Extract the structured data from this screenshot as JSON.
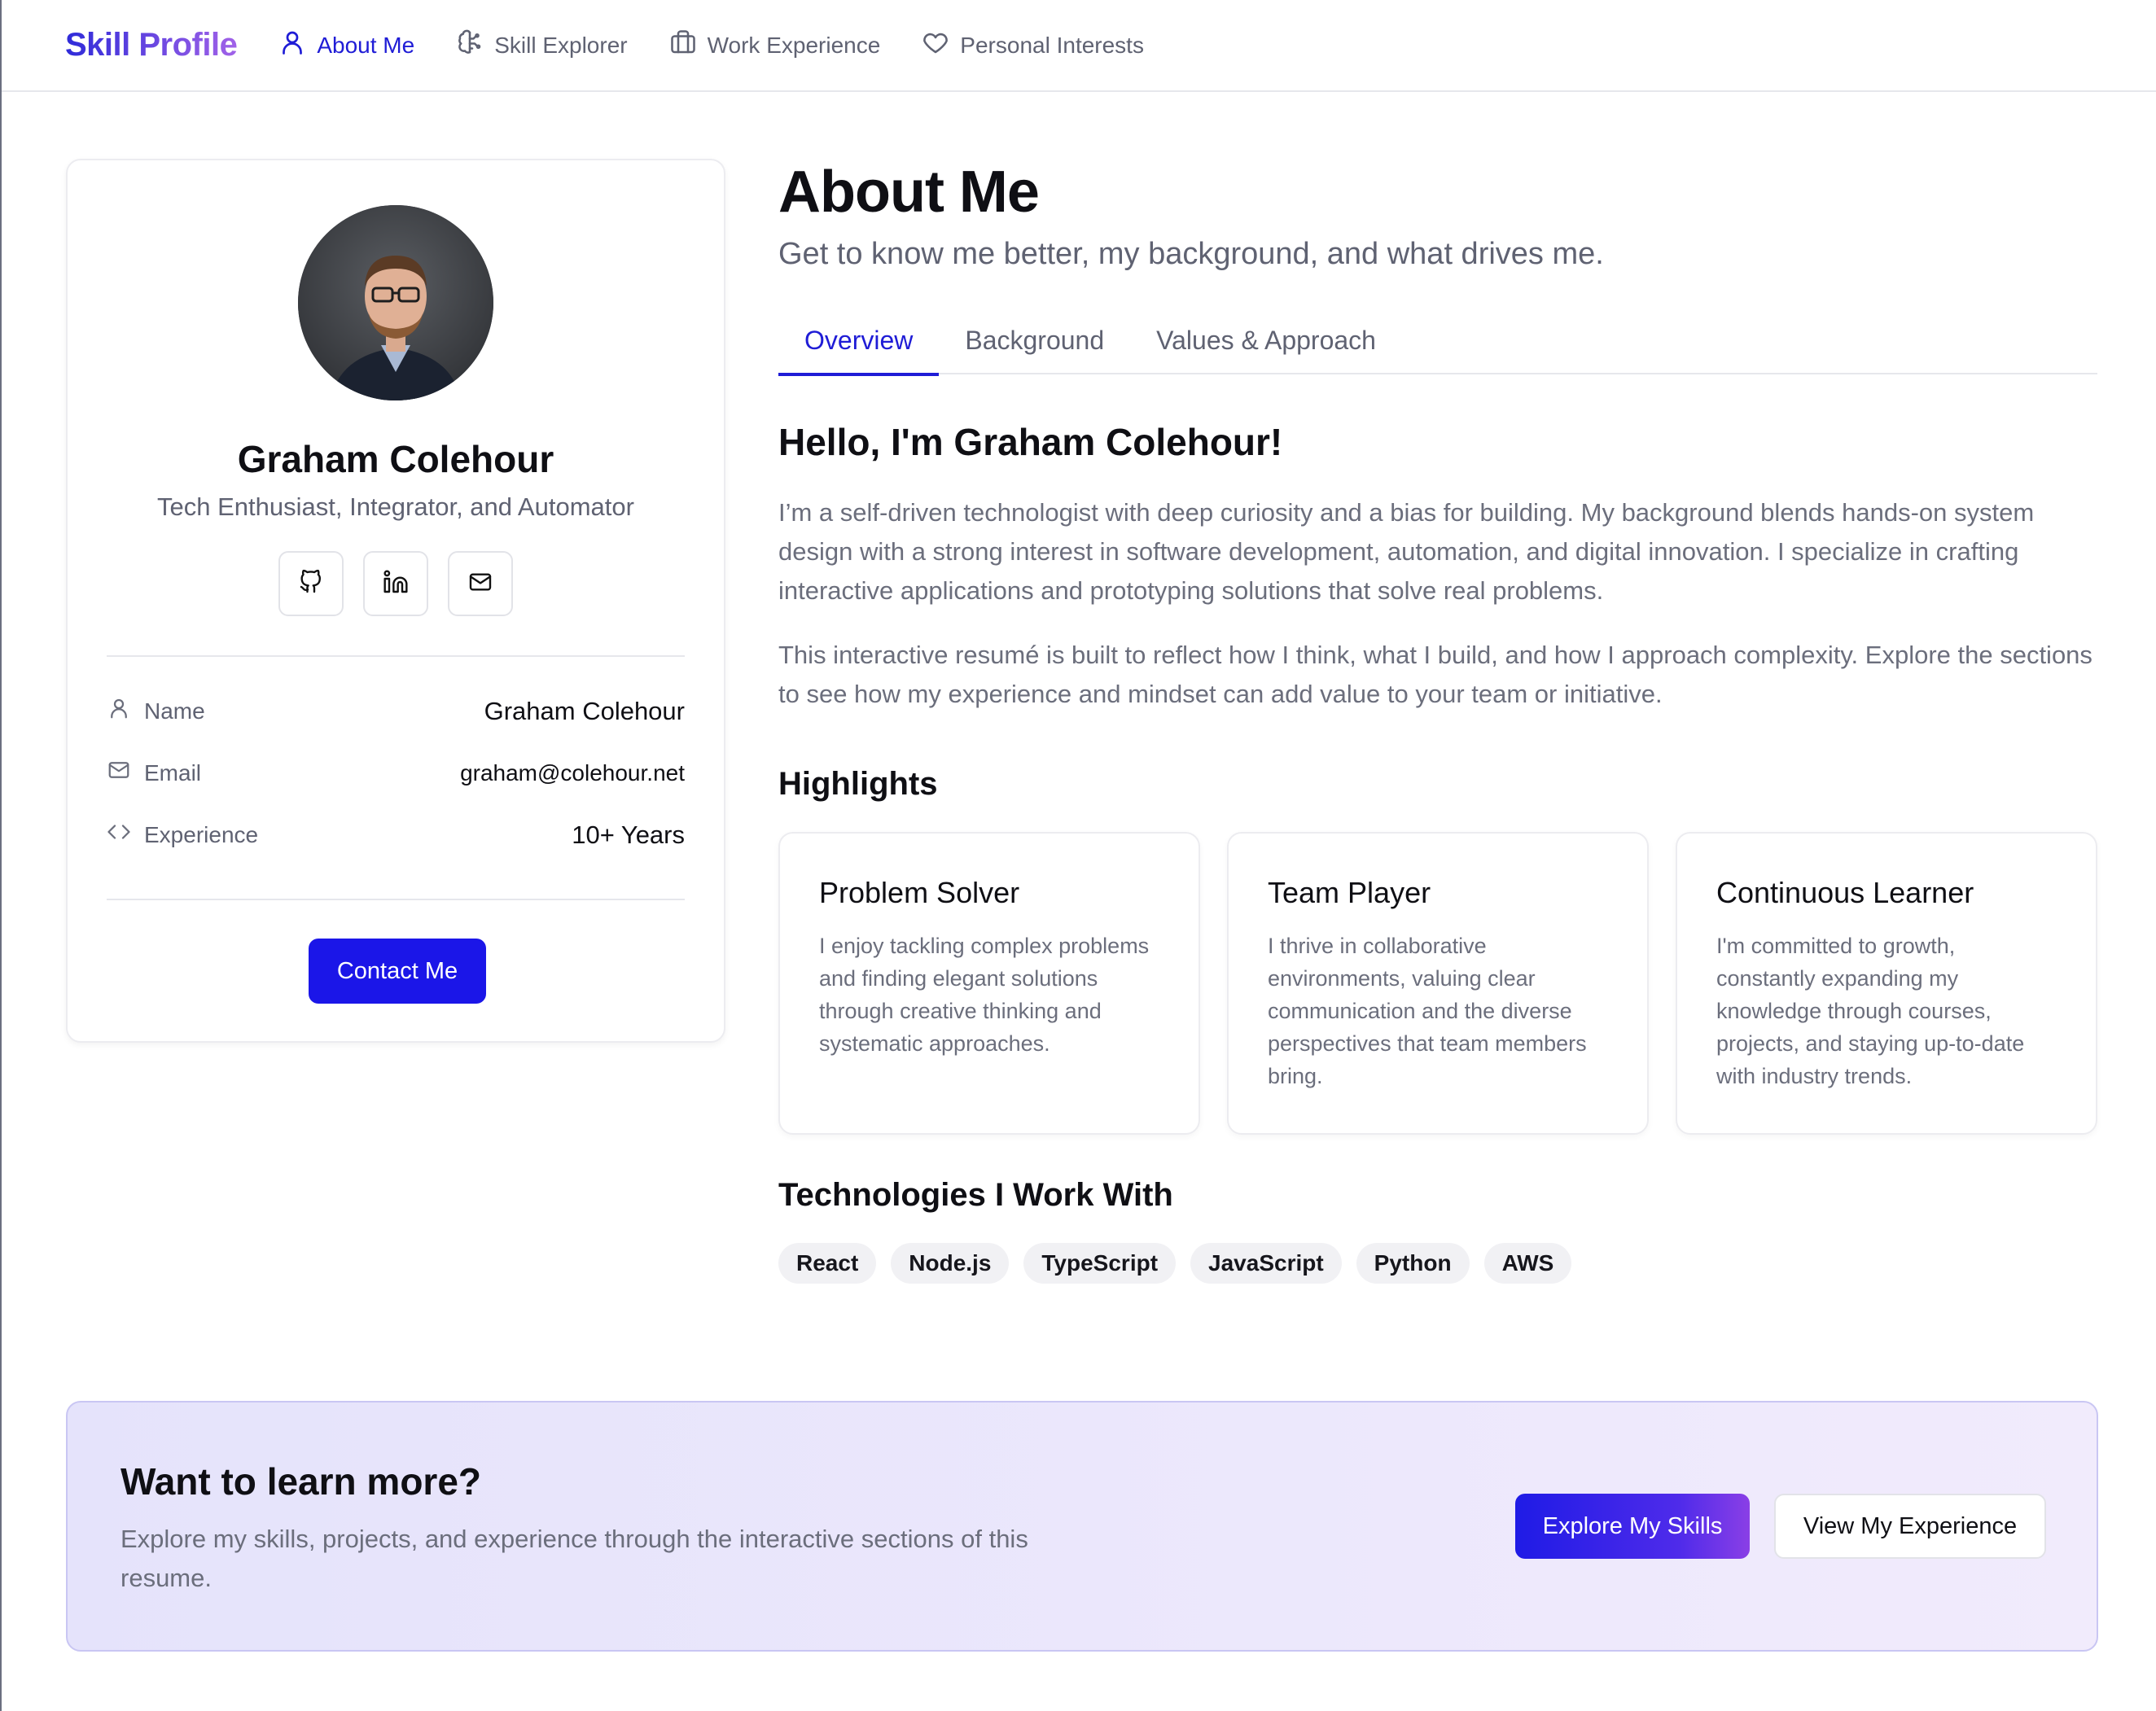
{
  "nav": {
    "brand": "Skill Profile",
    "items": [
      {
        "label": "About Me",
        "icon": "user-icon",
        "active": true
      },
      {
        "label": "Skill Explorer",
        "icon": "brain-icon",
        "active": false
      },
      {
        "label": "Work Experience",
        "icon": "briefcase-icon",
        "active": false
      },
      {
        "label": "Personal Interests",
        "icon": "heart-icon",
        "active": false
      }
    ]
  },
  "profile": {
    "name": "Graham Colehour",
    "title": "Tech Enthusiast, Integrator, and Automator",
    "socials": [
      "github-icon",
      "linkedin-icon",
      "mail-icon"
    ],
    "info": [
      {
        "label": "Name",
        "value": "Graham Colehour",
        "icon": "user-icon"
      },
      {
        "label": "Email",
        "value": "graham@colehour.net",
        "icon": "mail-icon"
      },
      {
        "label": "Experience",
        "value": "10+ Years",
        "icon": "code-icon"
      }
    ],
    "contact_label": "Contact Me"
  },
  "main": {
    "heading": "About Me",
    "subtitle": "Get to know me better, my background, and what drives me.",
    "tabs": [
      {
        "label": "Overview",
        "active": true
      },
      {
        "label": "Background",
        "active": false
      },
      {
        "label": "Values & Approach",
        "active": false
      }
    ],
    "hello": "Hello, I'm Graham Colehour!",
    "paragraphs": [
      "I’m a self-driven technologist with deep curiosity and a bias for building. My background blends hands-on system design with a strong interest in software development, automation, and digital innovation. I specialize in crafting interactive applications and prototyping solutions that solve real problems.",
      "This interactive resumé is built to reflect how I think, what I build, and how I approach complexity. Explore the sections to see how my experience and mindset can add value to your team or initiative."
    ],
    "highlights_heading": "Highlights",
    "highlights": [
      {
        "title": "Problem Solver",
        "text": "I enjoy tackling complex problems and finding elegant solutions through creative thinking and systematic approaches."
      },
      {
        "title": "Team Player",
        "text": "I thrive in collaborative environments, valuing clear communication and the diverse perspectives that team members bring."
      },
      {
        "title": "Continuous Learner",
        "text": "I'm committed to growth, constantly expanding my knowledge through courses, projects, and staying up-to-date with industry trends."
      }
    ],
    "tech_heading": "Technologies I Work With",
    "technologies": [
      "React",
      "Node.js",
      "TypeScript",
      "JavaScript",
      "Python",
      "AWS"
    ]
  },
  "cta": {
    "title": "Want to learn more?",
    "text": "Explore my skills, projects, and experience through the interactive sections of this resume.",
    "primary_label": "Explore My Skills",
    "secondary_label": "View My Experience"
  },
  "colors": {
    "accent": "#1b16e8",
    "brand_gradient_start": "#2f2bd9",
    "brand_gradient_end": "#a162e8",
    "muted_text": "#6b6e7c",
    "cta_background": "#e5e3fb"
  }
}
